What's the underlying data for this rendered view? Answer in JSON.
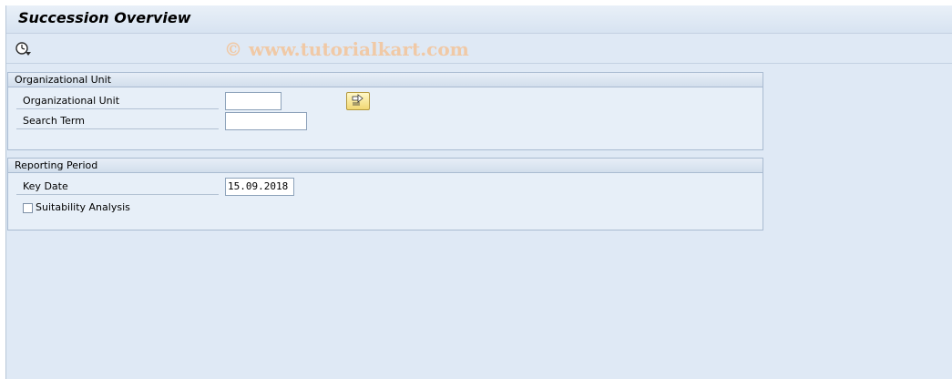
{
  "window": {
    "title": "Succession Overview"
  },
  "toolbar": {
    "execute_icon": "execute-clock-icon",
    "watermark": "© www.tutorialkart.com"
  },
  "org_unit_group": {
    "header": "Organizational Unit",
    "org_unit_label": "Organizational Unit",
    "org_unit_value": "",
    "search_term_label": "Search Term",
    "search_term_value": "",
    "more_button_icon": "arrow-right-icon"
  },
  "reporting_group": {
    "header": "Reporting Period",
    "key_date_label": "Key Date",
    "key_date_value": "15.09.2018",
    "suitability_label": "Suitability Analysis",
    "suitability_checked": false
  }
}
